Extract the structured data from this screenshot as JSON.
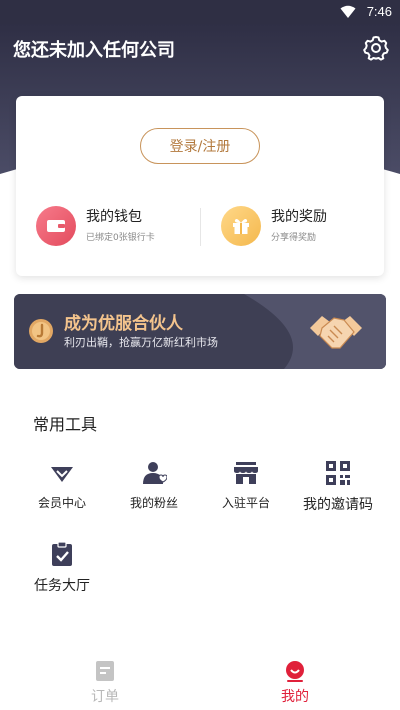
{
  "status_bar": {
    "time": "7:46"
  },
  "header": {
    "title": "您还未加入任何公司"
  },
  "account_card": {
    "login_button": "登录/注册",
    "wallet": {
      "title": "我的钱包",
      "subtitle": "已绑定0张银行卡"
    },
    "reward": {
      "title": "我的奖励",
      "subtitle": "分享得奖励"
    }
  },
  "banner": {
    "title": "成为优服合伙人",
    "subtitle": "利刃出鞘，抢赢万亿新红利市场"
  },
  "tools": {
    "title": "常用工具",
    "items": [
      {
        "label": "会员中心",
        "icon": "diamond-icon"
      },
      {
        "label": "我的粉丝",
        "icon": "user-heart-icon"
      },
      {
        "label": "入驻平台",
        "icon": "store-icon"
      },
      {
        "label": "我的邀请码",
        "icon": "qr-code-icon"
      },
      {
        "label": "任务大厅",
        "icon": "clipboard-check-icon"
      }
    ]
  },
  "tab_bar": {
    "tabs": [
      {
        "label": "订单",
        "icon": "orders-icon",
        "active": false
      },
      {
        "label": "我的",
        "icon": "profile-icon",
        "active": true
      }
    ]
  },
  "colors": {
    "header": "#3f4059",
    "accent_gold": "#c8945b",
    "active_tab": "#e0203a"
  }
}
